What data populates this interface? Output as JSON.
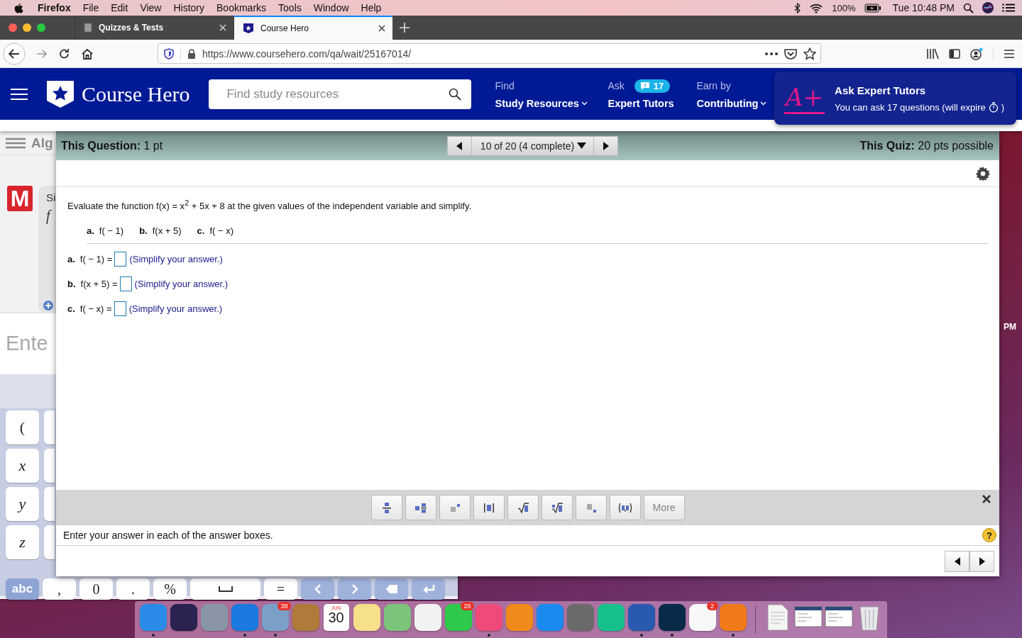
{
  "menubar": {
    "app": "Firefox",
    "menus": [
      "File",
      "Edit",
      "View",
      "History",
      "Bookmarks",
      "Tools",
      "Window",
      "Help"
    ],
    "battery": "100%",
    "clock": "Tue 10:48 PM"
  },
  "tabs": [
    {
      "title": "Quizzes & Tests",
      "selected": false
    },
    {
      "title": "Course Hero",
      "selected": true
    }
  ],
  "address_bar": {
    "url": "https://www.coursehero.com/qa/wait/25167014/"
  },
  "site_header": {
    "logo": "Course Hero",
    "search": {
      "placeholder": "Find study resources"
    },
    "nav": [
      {
        "top": "Find",
        "bottom": "Study Resources",
        "dropdown": true
      },
      {
        "top": "Ask",
        "badge": "17",
        "bottom": "Expert Tutors",
        "dropdown": false
      },
      {
        "top": "Earn by",
        "bottom": "Contributing",
        "dropdown": true
      }
    ],
    "promo": {
      "mark": "A+",
      "title": "Ask Expert Tutors",
      "text": "You can ask 17 questions (will expire",
      "text_end": ")"
    }
  },
  "background_app": {
    "title": "Alg",
    "logo_letter": "M",
    "card_text": "Si",
    "card_symbol": "f",
    "input_text": "Ente",
    "side_keys": [
      {
        "kind": "symbol",
        "label": "("
      },
      {
        "kind": "variable",
        "label": "x"
      },
      {
        "kind": "variable",
        "label": "y"
      },
      {
        "kind": "variable",
        "label": "z"
      }
    ],
    "bottom_keys": [
      {
        "kind": "mode",
        "label": "abc"
      },
      {
        "kind": "symbol",
        "label": ","
      },
      {
        "kind": "symbol",
        "label": "0"
      },
      {
        "kind": "symbol",
        "label": "."
      },
      {
        "kind": "symbol",
        "label": "%"
      },
      {
        "kind": "space"
      },
      {
        "kind": "symbol",
        "label": "="
      },
      {
        "kind": "left"
      },
      {
        "kind": "right"
      },
      {
        "kind": "backspace"
      },
      {
        "kind": "enter"
      }
    ]
  },
  "desktop_text": "PM",
  "quiz": {
    "question_points": {
      "label": "This Question:",
      "value": "1 pt"
    },
    "progress": "10 of 20 (4 complete)",
    "quiz_points": {
      "label": "This Quiz:",
      "value": "20 pts possible"
    },
    "prompt": "Evaluate the function f(x) = x$^{2}$ + 5x + 8 at the given values of the independent variable and simplify.",
    "parts": [
      {
        "label": "a.",
        "expr": "f( − 1)"
      },
      {
        "label": "b.",
        "expr": "f(x + 5)"
      },
      {
        "label": "c.",
        "expr": "f( − x)"
      }
    ],
    "answers": [
      {
        "label": "a.",
        "expr": "f( − 1) =",
        "hint": "(Simplify your answer.)"
      },
      {
        "label": "b.",
        "expr": "f(x + 5) =",
        "hint": "(Simplify your answer.)"
      },
      {
        "label": "c.",
        "expr": "f( − x) =",
        "hint": "(Simplify your answer.)"
      }
    ],
    "tools": [
      {
        "kind": "fraction"
      },
      {
        "kind": "mixed"
      },
      {
        "kind": "exponent"
      },
      {
        "kind": "abs"
      },
      {
        "kind": "sqrt"
      },
      {
        "kind": "nroot"
      },
      {
        "kind": "subscript"
      },
      {
        "kind": "pair"
      },
      {
        "kind": "text",
        "label": "More"
      }
    ],
    "instruction": "Enter your answer in each of the answer boxes.",
    "help": "?"
  },
  "dock": [
    {
      "kind": "app",
      "color": "#2a8ce8",
      "running": true
    },
    {
      "kind": "app",
      "color": "#2a2250",
      "running": false
    },
    {
      "kind": "app",
      "color": "#8a96a6",
      "running": false
    },
    {
      "kind": "app",
      "color": "#1a7ae0",
      "running": true
    },
    {
      "kind": "app",
      "color": "#7aa0c8",
      "running": true,
      "badge": "38"
    },
    {
      "kind": "app",
      "color": "#b07a3a",
      "running": false
    },
    {
      "kind": "calendar",
      "month": "JUN",
      "day": "30",
      "running": false
    },
    {
      "kind": "app",
      "color": "#f6e08a",
      "running": false
    },
    {
      "kind": "app",
      "color": "#7cc47a",
      "running": false
    },
    {
      "kind": "app",
      "color": "#f2f2f2",
      "running": false
    },
    {
      "kind": "app",
      "color": "#2ec84a",
      "running": false,
      "badge": "26"
    },
    {
      "kind": "app",
      "color": "#f04a7a",
      "running": true
    },
    {
      "kind": "app",
      "color": "#f08a1a",
      "running": false
    },
    {
      "kind": "app",
      "color": "#1a8af0",
      "running": false
    },
    {
      "kind": "app",
      "color": "#6a6a6a",
      "running": false
    },
    {
      "kind": "app",
      "color": "#16c08a",
      "running": false
    },
    {
      "kind": "app",
      "color": "#2a5ab0",
      "running": true
    },
    {
      "kind": "app",
      "color": "#0a2a4a",
      "running": true
    },
    {
      "kind": "app",
      "color": "#f8f8f8",
      "running": false,
      "badge": "2"
    },
    {
      "kind": "app",
      "color": "#f07a1a",
      "running": true
    },
    {
      "kind": "separator"
    },
    {
      "kind": "file",
      "running": false
    },
    {
      "kind": "window",
      "running": false
    },
    {
      "kind": "window",
      "running": false
    },
    {
      "kind": "trash",
      "running": false
    }
  ]
}
